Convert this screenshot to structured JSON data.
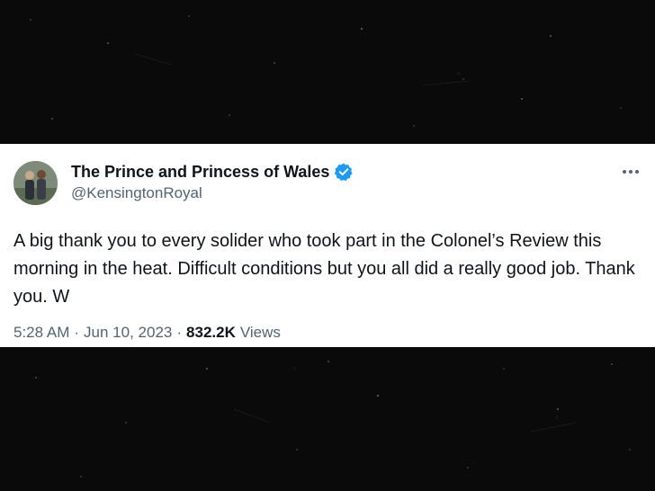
{
  "tweet": {
    "display_name": "The Prince and Princess of Wales",
    "handle": "@KensingtonRoyal",
    "verified": true,
    "text": "A big thank you to every solider who took part in the Colonel’s Review this morning in the heat. Difficult conditions but you all did a really good job. Thank you. W",
    "time": "5:28 AM",
    "separator": "·",
    "date": "Jun 10, 2023",
    "views_count": "832.2K",
    "views_label": "Views",
    "icons": {
      "verified": "verified-badge-icon",
      "more": "more-options-icon"
    }
  },
  "colors": {
    "background": "#0a0a0a",
    "card": "#ffffff",
    "text_primary": "#0f1419",
    "text_secondary": "#536471",
    "verified_blue": "#1d9bf0"
  }
}
